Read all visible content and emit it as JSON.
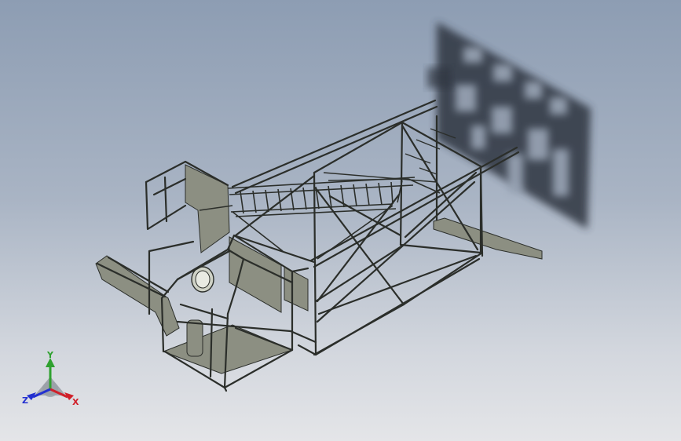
{
  "viewport": {
    "background_top": "#8d9db3",
    "background_bottom": "#e4e5e8",
    "model_edge_color": "#2b2e2a",
    "model_face_color": "#8c8f82",
    "shadow_color": "#2e3440"
  },
  "triad": {
    "x_label": "X",
    "y_label": "Y",
    "z_label": "Z",
    "x_color": "#d0202a",
    "y_color": "#2fa12f",
    "z_color": "#2330d0"
  }
}
